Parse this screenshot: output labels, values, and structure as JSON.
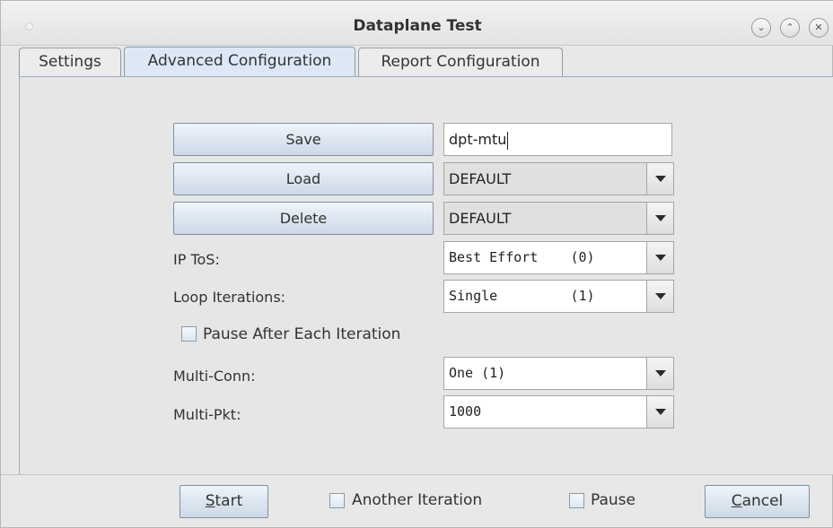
{
  "window": {
    "title": "Dataplane Test"
  },
  "tabs": [
    {
      "label": "Settings"
    },
    {
      "label": "Advanced Configuration"
    },
    {
      "label": "Report Configuration"
    }
  ],
  "advanced": {
    "save_label": "Save",
    "save_name_value": "dpt-mtu",
    "load_label": "Load",
    "load_value": "DEFAULT",
    "delete_label": "Delete",
    "delete_value": "DEFAULT",
    "ip_tos_label": "IP ToS:",
    "ip_tos_value": "Best Effort    (0)",
    "loop_label": "Loop Iterations:",
    "loop_value": "Single         (1)",
    "pause_each_label": "Pause After Each Iteration",
    "multi_conn_label": "Multi-Conn:",
    "multi_conn_value": "One (1)",
    "multi_pkt_label": "Multi-Pkt:",
    "multi_pkt_value": "1000"
  },
  "footer": {
    "start_mnemonic": "S",
    "start_rest": "tart",
    "another_iteration_label": "Another Iteration",
    "pause_label": "Pause",
    "cancel_mnemonic": "C",
    "cancel_rest": "ancel"
  },
  "icons": {
    "minimize": "chevron-down-icon",
    "maximize": "chevron-up-icon",
    "close": "close-icon"
  }
}
